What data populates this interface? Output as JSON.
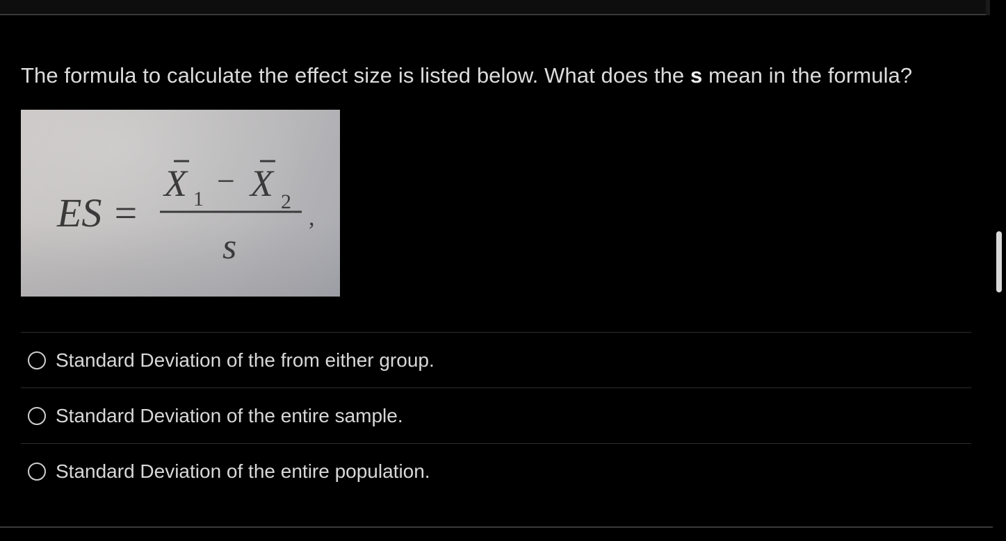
{
  "question": {
    "text_before": "The formula to calculate the effect size is listed below.  What does the ",
    "emphasis": "s",
    "text_after": " mean in the formula?"
  },
  "formula_image": {
    "lhs": "ES =",
    "numerator_x1": "X",
    "numerator_sub1": "1",
    "minus": "−",
    "numerator_x2": "X",
    "numerator_sub2": "2",
    "denominator": "s",
    "trailing": ","
  },
  "options": [
    {
      "label": "Standard Deviation of the from either group."
    },
    {
      "label": "Standard Deviation of the entire sample."
    },
    {
      "label": "Standard Deviation of the entire population."
    }
  ],
  "colors": {
    "background": "#000000",
    "text": "#dcdcdc",
    "divider": "#2e2e2e",
    "radio_border": "#cfcfcf"
  }
}
